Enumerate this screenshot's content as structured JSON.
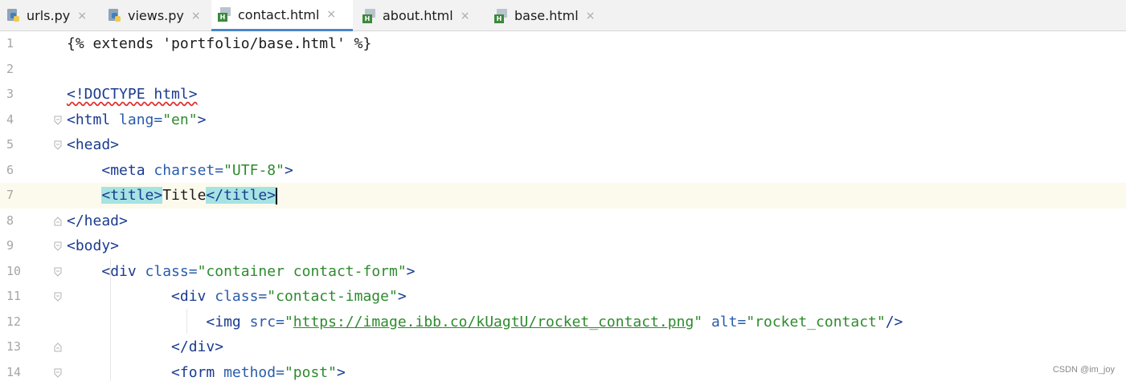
{
  "tabs": [
    {
      "label": "urls.py",
      "type": "python",
      "active": false
    },
    {
      "label": "views.py",
      "type": "python",
      "active": false
    },
    {
      "label": "contact.html",
      "type": "html",
      "active": true
    },
    {
      "label": "about.html",
      "type": "html",
      "active": false
    },
    {
      "label": "base.html",
      "type": "html",
      "active": false
    }
  ],
  "tab_close_glyph": "×",
  "html_badge": "H",
  "editor": {
    "current_line": 7,
    "lines": [
      {
        "num": "1",
        "segments": [
          {
            "t": "{% extends 'portfolio/base.html' %}",
            "c": "plain"
          }
        ]
      },
      {
        "num": "2",
        "segments": []
      },
      {
        "num": "3",
        "segments": [
          {
            "t": "<!DOCTYPE html>",
            "c": "tag-err"
          }
        ]
      },
      {
        "num": "4",
        "segments": [
          {
            "t": "<html ",
            "c": "tag"
          },
          {
            "t": "lang=",
            "c": "attr"
          },
          {
            "t": "\"en\"",
            "c": "val"
          },
          {
            "t": ">",
            "c": "tag"
          }
        ]
      },
      {
        "num": "5",
        "segments": [
          {
            "t": "<head>",
            "c": "tag"
          }
        ]
      },
      {
        "num": "6",
        "segments": [
          {
            "t": "    ",
            "c": "plain"
          },
          {
            "t": "<meta ",
            "c": "tag"
          },
          {
            "t": "charset=",
            "c": "attr"
          },
          {
            "t": "\"UTF-8\"",
            "c": "val"
          },
          {
            "t": ">",
            "c": "tag"
          }
        ]
      },
      {
        "num": "7",
        "segments": [
          {
            "t": "    ",
            "c": "plain"
          },
          {
            "t": "<title>",
            "c": "tag-hl"
          },
          {
            "t": "Title",
            "c": "plain"
          },
          {
            "t": "</title>",
            "c": "tag-hl"
          }
        ]
      },
      {
        "num": "8",
        "segments": [
          {
            "t": "</head>",
            "c": "tag"
          }
        ]
      },
      {
        "num": "9",
        "segments": [
          {
            "t": "<body>",
            "c": "tag"
          }
        ]
      },
      {
        "num": "10",
        "segments": [
          {
            "t": "    ",
            "c": "plain"
          },
          {
            "t": "<div ",
            "c": "tag"
          },
          {
            "t": "class=",
            "c": "attr"
          },
          {
            "t": "\"container contact-form\"",
            "c": "val"
          },
          {
            "t": ">",
            "c": "tag"
          }
        ]
      },
      {
        "num": "11",
        "segments": [
          {
            "t": "            ",
            "c": "plain"
          },
          {
            "t": "<div ",
            "c": "tag"
          },
          {
            "t": "class=",
            "c": "attr"
          },
          {
            "t": "\"contact-image\"",
            "c": "val"
          },
          {
            "t": ">",
            "c": "tag"
          }
        ]
      },
      {
        "num": "12",
        "segments": [
          {
            "t": "                ",
            "c": "plain"
          },
          {
            "t": "<img ",
            "c": "tag"
          },
          {
            "t": "src=",
            "c": "attr"
          },
          {
            "t": "\"",
            "c": "val"
          },
          {
            "t": "https://image.ibb.co/kUagtU/rocket_contact.png",
            "c": "url"
          },
          {
            "t": "\" ",
            "c": "val"
          },
          {
            "t": "alt=",
            "c": "attr"
          },
          {
            "t": "\"rocket_contact\"",
            "c": "val"
          },
          {
            "t": "/>",
            "c": "tag"
          }
        ]
      },
      {
        "num": "13",
        "segments": [
          {
            "t": "            ",
            "c": "plain"
          },
          {
            "t": "</div>",
            "c": "tag"
          }
        ]
      },
      {
        "num": "14",
        "segments": [
          {
            "t": "            ",
            "c": "plain"
          },
          {
            "t": "<form ",
            "c": "tag"
          },
          {
            "t": "method=",
            "c": "attr"
          },
          {
            "t": "\"post\"",
            "c": "val"
          },
          {
            "t": ">",
            "c": "tag"
          }
        ]
      }
    ],
    "fold_markers": {
      "4": "open",
      "5": "open",
      "8": "close",
      "9": "open",
      "10": "open",
      "11": "open",
      "13": "close",
      "14": "open"
    }
  },
  "watermark": "CSDN @im_joy"
}
